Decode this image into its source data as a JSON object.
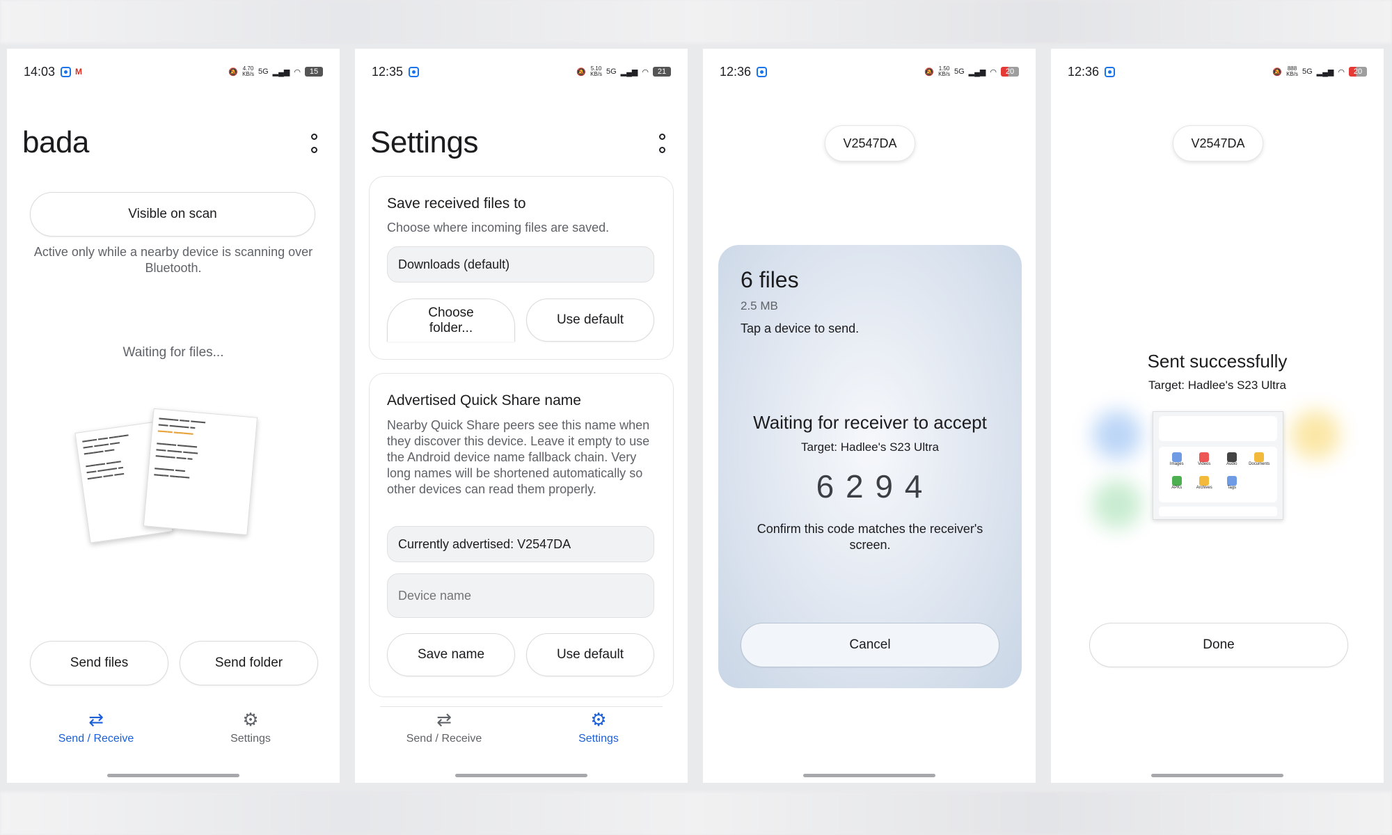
{
  "screen1": {
    "status": {
      "time": "14:03",
      "speed_top": "4.70",
      "speed_bottom": "KB/s",
      "net": "5G",
      "battery": "15"
    },
    "title": "bada",
    "visible_button": "Visible on scan",
    "visible_hint": "Active only while a nearby device is scanning over Bluetooth.",
    "waiting": "Waiting for files...",
    "send_files": "Send files",
    "send_folder": "Send folder"
  },
  "screen2": {
    "status": {
      "time": "12:35",
      "speed_top": "5.10",
      "speed_bottom": "KB/s",
      "net": "5G",
      "battery": "21"
    },
    "title": "Settings",
    "save_card": {
      "heading": "Save received files to",
      "desc": "Choose where incoming files are saved.",
      "current": "Downloads (default)",
      "choose": "Choose folder...",
      "use_default": "Use default"
    },
    "name_card": {
      "heading": "Advertised Quick Share name",
      "desc": "Nearby Quick Share peers see this name when they discover this device. Leave it empty to use the Android device name fallback chain. Very long names will be shortened automatically so other devices can read them properly.",
      "current": "Currently advertised: V2547DA",
      "placeholder": "Device name",
      "save": "Save name",
      "use_default": "Use default"
    }
  },
  "nav": {
    "send_receive": "Send / Receive",
    "settings": "Settings"
  },
  "screen3": {
    "status": {
      "time": "12:36",
      "speed_top": "1.50",
      "speed_bottom": "KB/s",
      "net": "5G",
      "battery": "20"
    },
    "device": "V2547DA",
    "files": "6 files",
    "size": "2.5 MB",
    "tap_hint": "Tap a device to send.",
    "waiting": "Waiting for receiver to accept",
    "target": "Target: Hadlee's S23 Ultra",
    "code": "6 2 9 4",
    "confirm": "Confirm this code matches the receiver's screen.",
    "cancel": "Cancel"
  },
  "screen4": {
    "status": {
      "time": "12:36",
      "speed_top": "888",
      "speed_bottom": "KB/s",
      "net": "5G",
      "battery": "20"
    },
    "device": "V2547DA",
    "sent": "Sent successfully",
    "target": "Target: Hadlee's S23 Ultra",
    "done": "Done",
    "preview_labels": [
      "Images",
      "Videos",
      "Audio",
      "Documents",
      "APKs",
      "Archives",
      "Tags"
    ]
  },
  "colors": {
    "accent": "#1a5fd8",
    "card_gradient_edge": "#c9d6e6"
  }
}
